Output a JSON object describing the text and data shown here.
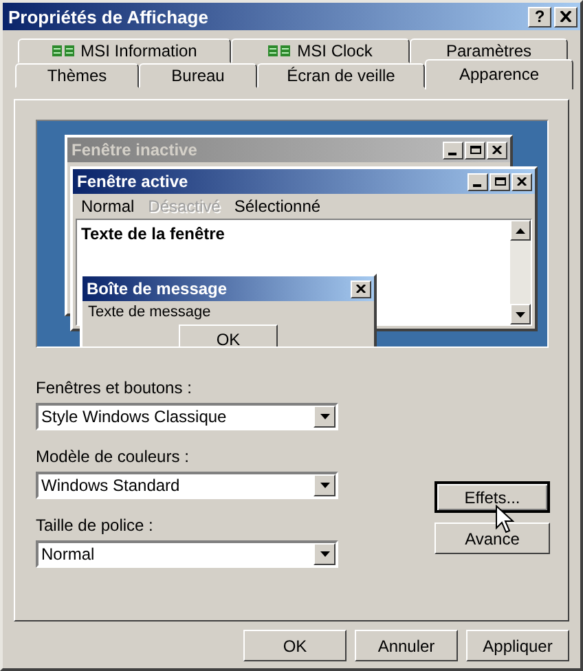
{
  "window": {
    "title": "Propriétés de Affichage",
    "help_button": "?"
  },
  "tabs": {
    "row_1": [
      {
        "label": "MSI Information",
        "kind": "with_icon",
        "selected": false
      },
      {
        "label": "MSI Clock",
        "kind": "with_icon",
        "selected": false
      },
      {
        "label": "Paramètres",
        "kind": "plain",
        "selected": false
      }
    ],
    "row_2": [
      {
        "label": "Thèmes",
        "selected": false
      },
      {
        "label": "Bureau",
        "selected": false
      },
      {
        "label": "Écran de veille",
        "selected": false
      },
      {
        "label": "Apparence",
        "selected": true
      }
    ]
  },
  "preview": {
    "inactive_window": {
      "title": "Fenêtre inactive"
    },
    "active_window": {
      "title": "Fenêtre active",
      "menu": [
        {
          "label": "Normal",
          "disabled": false
        },
        {
          "label": "Désactivé",
          "disabled": true
        },
        {
          "label": "Sélectionné",
          "disabled": false
        }
      ],
      "text": "Texte de la fenêtre"
    },
    "message_box": {
      "title": "Boîte de message",
      "text": "Texte de message",
      "button": "OK"
    }
  },
  "fields": [
    {
      "label": "Fenêtres et boutons :",
      "value": "Style Windows Classique"
    },
    {
      "label": "Modèle de couleurs :",
      "value": "Windows Standard"
    },
    {
      "label": "Taille de police :",
      "value": "Normal"
    }
  ],
  "side_buttons": [
    {
      "label": "Effets...",
      "focused": true
    },
    {
      "label": "Avance",
      "focused": false
    }
  ],
  "buttons": [
    "OK",
    "Annuler",
    "Appliquer"
  ]
}
